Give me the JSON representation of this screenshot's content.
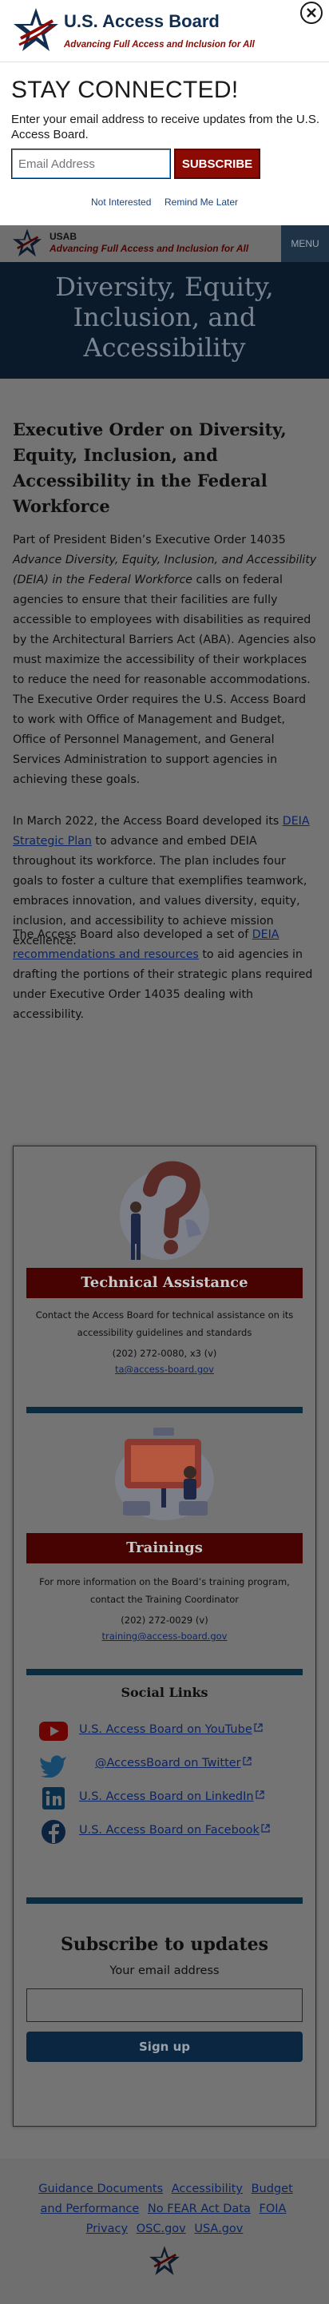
{
  "popup": {
    "title": "U.S. Access Board",
    "tagline": "Advancing Full Access and Inclusion for All",
    "heading": "STAY CONNECTED!",
    "text": "Enter your email address to receive updates from the U.S. Access Board.",
    "email_placeholder": "Email Address",
    "subscribe_label": "SUBSCRIBE",
    "not_interested_label": "Not Interested",
    "remind_label": "Remind Me Later",
    "close_icon": "close-icon"
  },
  "header": {
    "abbr": "USAB",
    "tagline": "Advancing Full Access and Inclusion for All",
    "menu_label": "MENU"
  },
  "hero": {
    "title": "Diversity, Equity, Inclusion, and Accessibility"
  },
  "article": {
    "title": "Executive Order on Diversity, Equity, Inclusion, and Accessibility in the Federal Workforce",
    "para1_a": "Part of President Biden’s Executive Order 14035 ",
    "para1_italic": "Advance Diversity, Equity, Inclusion, and Accessibility (DEIA) in the Federal Workforce",
    "para1_b": " calls on federal agencies to ensure that their facilities are fully accessible to employees with disabilities as required by the Architectural Barriers Act (ABA). Agencies also must maximize the accessibility of their workplaces to reduce the need for reasonable accommodations. The Executive Order requires the U.S. Access Board to work with Office of Management and Budget, Office of Personnel Management, and General Services Administration to support agencies in achieving these goals.",
    "para2_a": "In March 2022, the Access Board developed its ",
    "para2_link": "DEIA Strategic Plan",
    "para2_b": " to advance and embed DEIA throughout its workforce. The plan includes four goals to foster a culture that exemplifies teamwork, embraces innovation, and values diversity, equity, inclusion, and accessibility to achieve mission excellence.",
    "para3_a": "The Access Board also developed a set of ",
    "para3_link": "DEIA recommendations and resources",
    "para3_b": " to aid agencies in drafting the portions of their strategic plans required under Executive Order 14035 dealing with accessibility."
  },
  "sidebar": {
    "technical": {
      "heading": "Technical Assistance",
      "text": "Contact the Access Board for technical assistance on its accessibility guidelines and standards",
      "phone": "(202) 272-0080, x3 (v)",
      "email": "ta@access-board.gov"
    },
    "trainings": {
      "heading": "Trainings",
      "text": "For more information on the Board’s training program, contact the Training Coordinator",
      "phone": "(202) 272-0029 (v)",
      "email": "training@access-board.gov"
    },
    "social": {
      "heading": "Social Links",
      "links": [
        {
          "label": "U.S. Access Board on YouTube",
          "icon": "youtube-icon"
        },
        {
          "label": "@AccessBoard on Twitter",
          "icon": "twitter-icon"
        },
        {
          "label": "U.S. Access Board on LinkedIn",
          "icon": "linkedin-icon"
        },
        {
          "label": "U.S. Access Board on Facebook",
          "icon": "facebook-icon"
        }
      ]
    },
    "subscribe": {
      "heading": "Subscribe to updates",
      "label": "Your email address",
      "button": "Sign up"
    }
  },
  "footer": {
    "links": [
      "Guidance Documents",
      "Accessibility",
      "Budget and Performance",
      "No FEAR Act Data",
      "FOIA",
      "Privacy",
      "OSC.gov",
      "USA.gov"
    ]
  },
  "colors": {
    "brand_navy": "#112e51",
    "brand_red": "#8b0a03",
    "overlay_gray": "#747474"
  }
}
